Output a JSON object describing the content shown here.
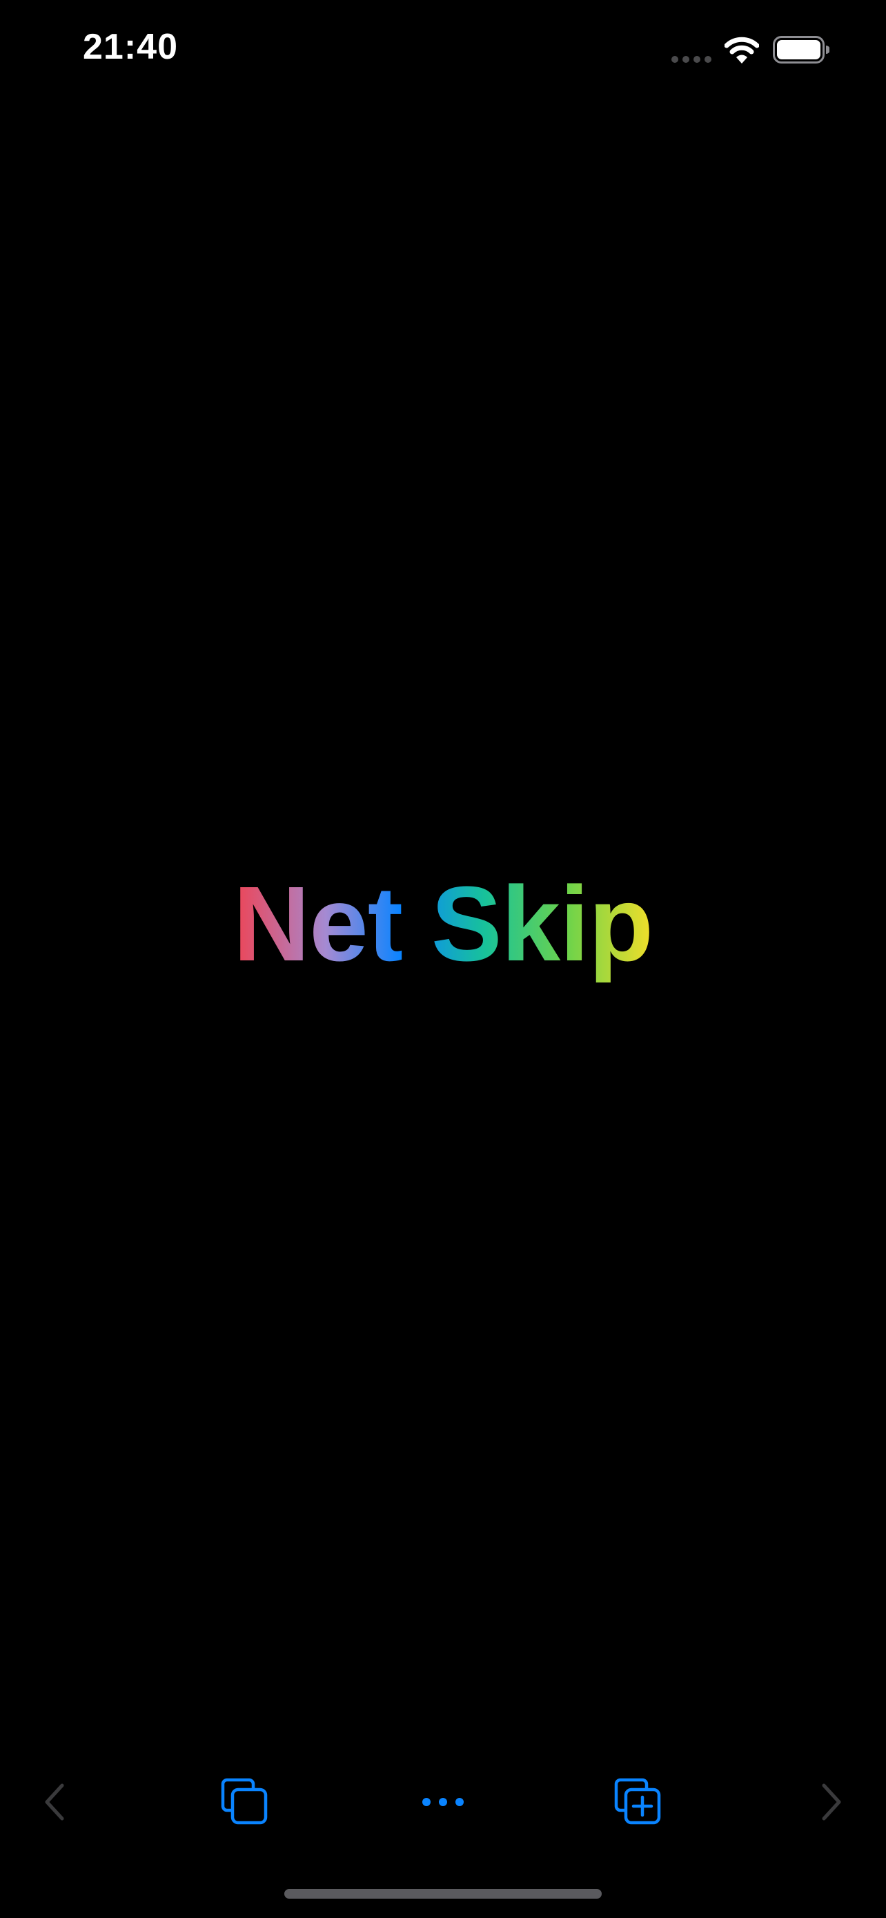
{
  "status_bar": {
    "time": "21:40",
    "icons": [
      "signal-icon",
      "wifi-icon",
      "battery-icon"
    ]
  },
  "logo": {
    "text": "Net Skip",
    "gradient": [
      "#ee4455",
      "#a58ad2",
      "#0a84ff",
      "#18c29a",
      "#6fd34a",
      "#f2de2a"
    ]
  },
  "toolbar": {
    "items": [
      {
        "name": "back-button",
        "icon": "chevron-left-icon",
        "enabled": false
      },
      {
        "name": "tabs-button",
        "icon": "tabs-icon",
        "enabled": true
      },
      {
        "name": "more-button",
        "icon": "ellipsis-icon",
        "enabled": true
      },
      {
        "name": "new-tab-button",
        "icon": "new-tab-icon",
        "enabled": true
      },
      {
        "name": "forward-button",
        "icon": "chevron-right-icon",
        "enabled": false
      }
    ]
  },
  "colors": {
    "background": "#000000",
    "accent": "#0a84ff",
    "disabled": "#3a3a3c",
    "home_indicator": "#5a5a5e"
  }
}
